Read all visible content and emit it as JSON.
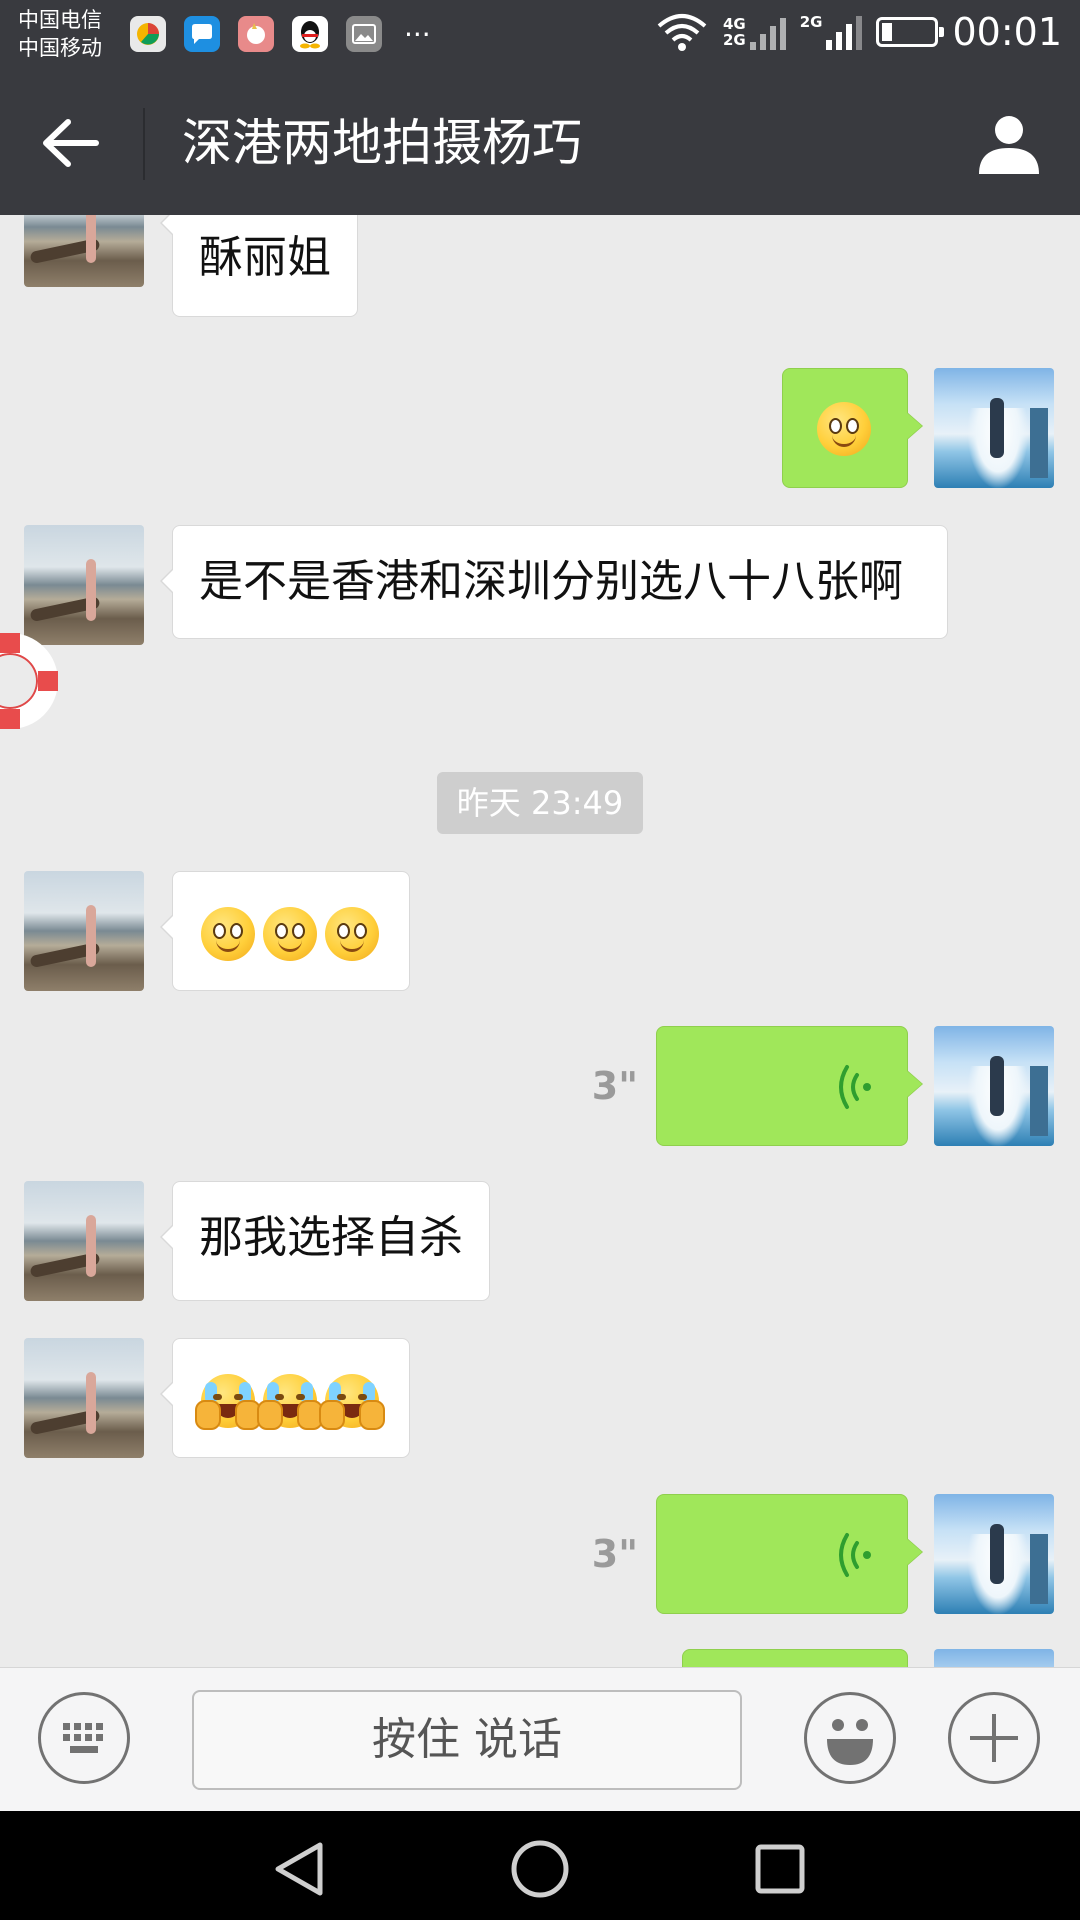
{
  "status_bar": {
    "carrier_1": "中国电信",
    "carrier_2": "中国移动",
    "net_1a": "4G",
    "net_1b": "2G",
    "net_2": "2G",
    "time": "00:01"
  },
  "header": {
    "title": "深港两地拍摄杨巧"
  },
  "messages": [
    {
      "side": "left",
      "kind": "text",
      "text": "酥丽姐"
    },
    {
      "side": "right",
      "kind": "emoji",
      "emoji": "smile",
      "count": 1
    },
    {
      "side": "left",
      "kind": "text",
      "text": "是不是香港和深圳分别选八十八张啊"
    },
    {
      "kind": "timestamp",
      "text": "昨天 23:49"
    },
    {
      "side": "left",
      "kind": "emoji",
      "emoji": "smile",
      "count": 3
    },
    {
      "side": "right",
      "kind": "voice",
      "duration": "3\""
    },
    {
      "side": "left",
      "kind": "text",
      "text": "那我选择自杀"
    },
    {
      "side": "left",
      "kind": "emoji",
      "emoji": "facepalm-cry",
      "count": 3
    },
    {
      "side": "right",
      "kind": "voice",
      "duration": "3\""
    },
    {
      "side": "right",
      "kind": "voice",
      "duration": ""
    }
  ],
  "input_bar": {
    "hold_to_talk": "按住 说话"
  },
  "icons": [
    "back-arrow-icon",
    "user-profile-icon",
    "keyboard-icon",
    "emoji-icon",
    "plus-icon",
    "nav-back-icon",
    "nav-home-icon",
    "nav-recents-icon",
    "voice-wave-icon",
    "lifebuoy-float-icon"
  ],
  "colors": {
    "header_bg": "#393a3f",
    "chat_bg": "#ebebeb",
    "sent_bubble": "#a0e75a",
    "received_bubble": "#ffffff",
    "voice_wave": "#2f9e2f"
  }
}
